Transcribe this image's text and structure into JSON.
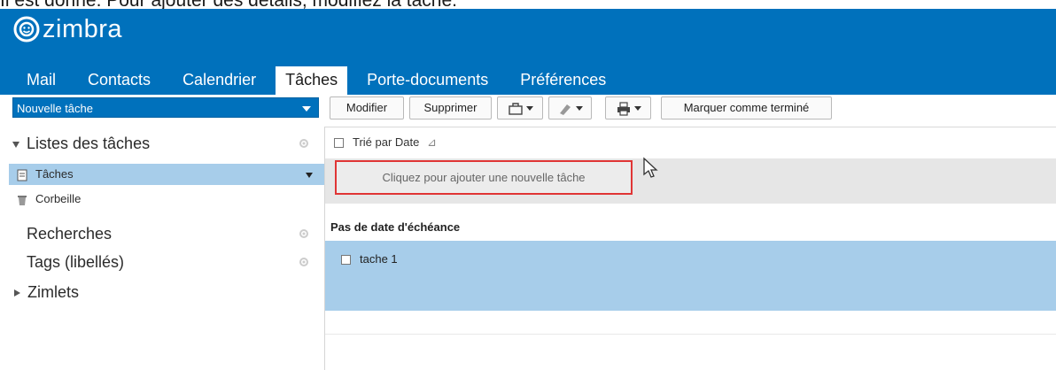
{
  "caption": "Il est donné. Pour ajouter des détails, modifiez la tâche.",
  "app": {
    "logo_text": "zimbra"
  },
  "tabs": [
    {
      "label": "Mail"
    },
    {
      "label": "Contacts"
    },
    {
      "label": "Calendrier"
    },
    {
      "label": "Tâches",
      "active": true
    },
    {
      "label": "Porte-documents"
    },
    {
      "label": "Préférences"
    }
  ],
  "toolbar": {
    "new_task": "Nouvelle tâche",
    "modifier": "Modifier",
    "supprimer": "Supprimer",
    "mark_done": "Marquer comme terminé"
  },
  "sidebar": {
    "task_lists": "Listes des tâches",
    "taches": "Tâches",
    "corbeille": "Corbeille",
    "recherches": "Recherches",
    "tags": "Tags (libellés)",
    "zimlets": "Zimlets"
  },
  "main": {
    "sort_label": "Trié par Date",
    "add_task": "Cliquez pour ajouter une nouvelle tâche",
    "group_header": "Pas de date d'échéance",
    "tasks": [
      {
        "name": "tache 1"
      }
    ]
  },
  "colors": {
    "brand": "#0071bc",
    "selection": "#a7cdea",
    "highlight": "#e03535"
  }
}
